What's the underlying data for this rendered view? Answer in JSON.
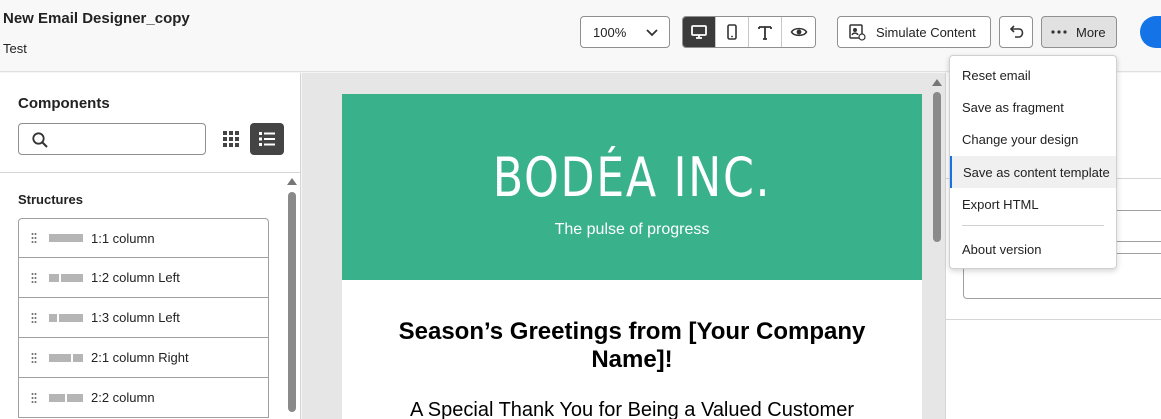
{
  "header": {
    "title": "New Email Designer_copy",
    "subtitle": "Test",
    "zoom_value": "100%",
    "view_buttons": [
      "desktop-view",
      "mobile-view",
      "text-view",
      "preview-view"
    ],
    "simulate_label": "Simulate Content",
    "more_label": "More"
  },
  "left_panel": {
    "title": "Components",
    "search_placeholder": "",
    "section_title": "Structures",
    "structures": [
      {
        "label": "1:1 column"
      },
      {
        "label": "1:2 column Left"
      },
      {
        "label": "1:3 column Left"
      },
      {
        "label": "2:1 column Right"
      },
      {
        "label": "2:2 column"
      }
    ]
  },
  "email": {
    "brand": "BODÉA INC.",
    "tagline": "The pulse of progress",
    "headline": "Season’s Greetings from [Your Company Name]!",
    "subline": "A Special Thank You for Being a Valued Customer"
  },
  "menu": {
    "items": [
      {
        "label": "Reset email"
      },
      {
        "label": "Save as fragment"
      },
      {
        "label": "Change your design"
      },
      {
        "label": "Save as content template"
      },
      {
        "label": "Export HTML"
      },
      {
        "label": "About version"
      }
    ]
  },
  "colors": {
    "brand_green": "#39b28b",
    "accent_blue": "#1473e6",
    "active_dark": "#3b3b3b"
  }
}
